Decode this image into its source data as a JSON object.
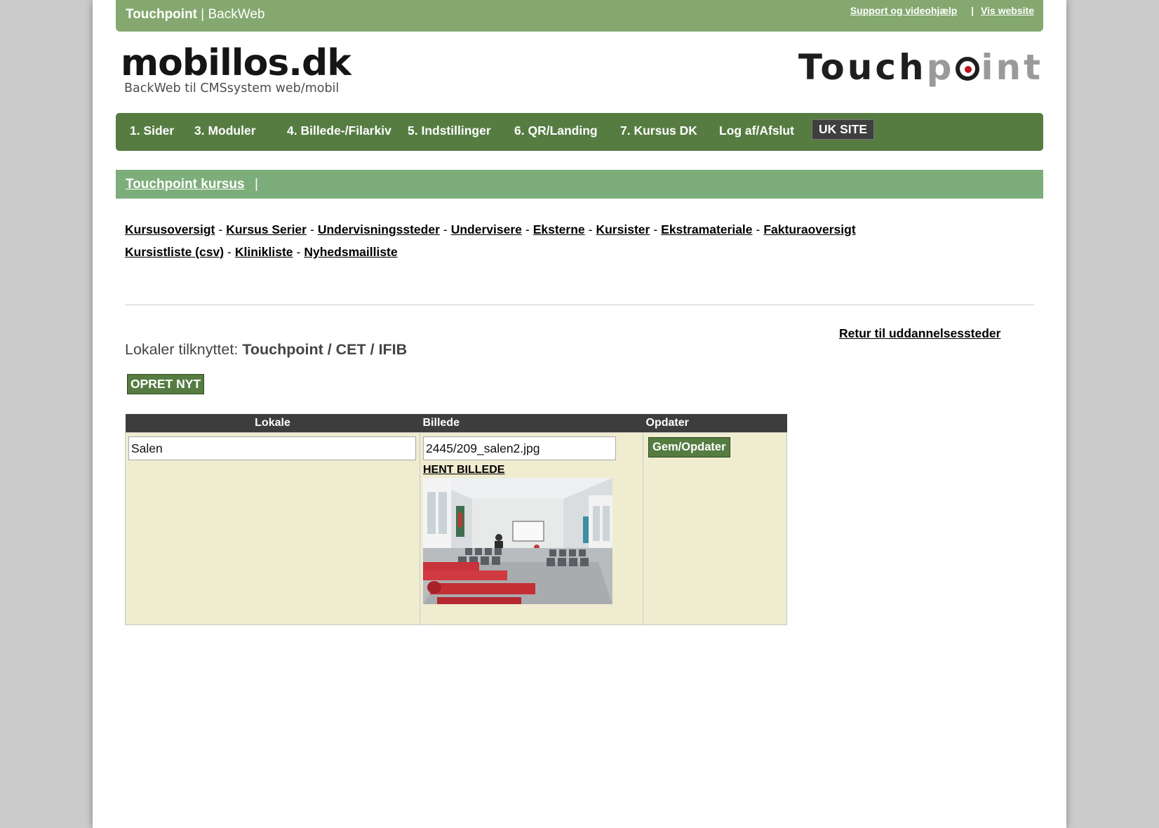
{
  "topbar": {
    "brand_bold": "Touchpoint",
    "brand_rest": "| BackWeb",
    "support_link": "Support og videohjælp",
    "separator": "|",
    "website_link": "Vis website"
  },
  "logo_left": {
    "title": "mobillos.dk",
    "subtitle": "BackWeb til CMSsystem web/mobil"
  },
  "logo_right": {
    "part1": "Touch",
    "part2_a": "p",
    "part2_b": "int"
  },
  "nav": {
    "items": [
      "1. Sider",
      "3. Moduler",
      "4. Billede-/Filarkiv",
      "5. Indstillinger",
      "6. QR/Landing",
      "7. Kursus DK",
      "Log af/Afslut"
    ],
    "uk_button": "UK SITE"
  },
  "subbar": {
    "title": "Touchpoint kursus",
    "pipe": "|"
  },
  "sublinks": {
    "row1": [
      "Kursusoversigt",
      "Kursus Serier",
      "Undervisningssteder",
      "Undervisere",
      "Eksterne",
      "Kursister",
      "Ekstramateriale",
      "Fakturaoversigt"
    ],
    "row2": [
      "Kursistliste (csv)",
      "Klinikliste",
      "Nyhedsmailliste"
    ],
    "separator": "-"
  },
  "return_link": "Retur til uddannelsessteder",
  "heading": {
    "prefix": "Lokaler tilknyttet:",
    "value": "Touchpoint / CET / IFIB"
  },
  "new_button": "OPRET NYT",
  "table": {
    "headers": [
      "Lokale",
      "Billede",
      "Opdater"
    ],
    "rows": [
      {
        "lokale": "Salen",
        "billede": "2445/209_salen2.jpg",
        "fetch_label": "HENT BILLEDE",
        "save_label": "Gem/Opdater"
      }
    ]
  },
  "colors": {
    "topbar": "#84a86f",
    "nav": "#567c42",
    "subbar": "#7dad7a",
    "table_header": "#3d3d3d",
    "table_cell": "#f0ecd0"
  }
}
